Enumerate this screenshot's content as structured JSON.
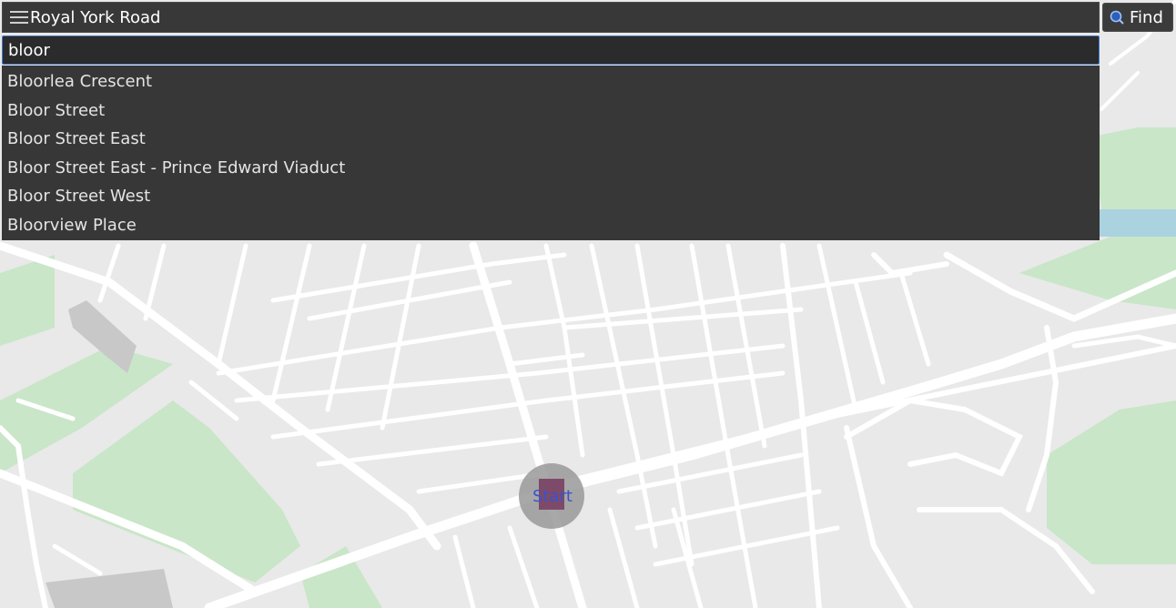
{
  "window": {
    "title": "Royal York Road"
  },
  "toolbar": {
    "find_label": "Find",
    "find_icon": "search-icon",
    "menu_icon": "hamburger-menu-icon"
  },
  "search": {
    "value": "bloor "
  },
  "suggestions": [
    "Bloorlea Crescent",
    "Bloor Street",
    "Bloor Street East",
    "Bloor Street East - Prince Edward Viaduct",
    "Bloor Street West",
    "Bloorview Place"
  ],
  "map": {
    "marker_label": "Start",
    "colors": {
      "land": "#e9e9e9",
      "road": "#ffffff",
      "park": "#c9e6c8",
      "building": "#c8c8c8",
      "water": "#aad3df",
      "marker_outer": "#999999",
      "marker_inner": "#7d4a6a",
      "marker_text": "#3a53cc"
    }
  }
}
